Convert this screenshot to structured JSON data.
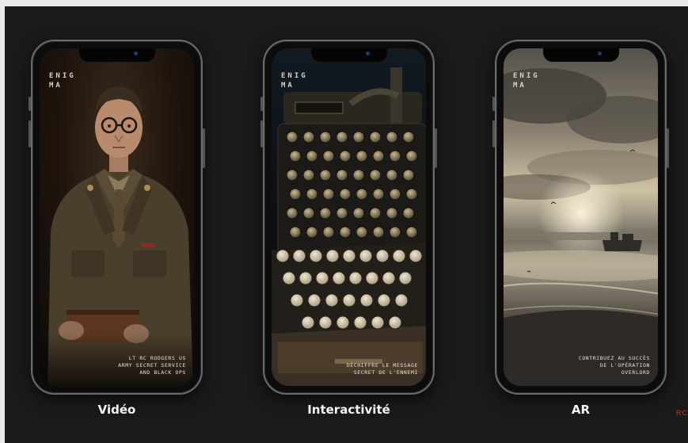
{
  "phones": [
    {
      "logo": "ENIGMA",
      "caption_lines": [
        "LT RC RODGERS US",
        "ARMY SECRET SERVICE",
        "AND BLACK OPS"
      ],
      "label": "Vidéo"
    },
    {
      "logo": "ENIGMA",
      "caption_lines": [
        "DÉCHIFFRE LE MESSAGE",
        "SECRET DE L'ENNEMI"
      ],
      "label": "Interactivité"
    },
    {
      "logo": "ENIGMA",
      "caption_lines": [
        "CONTRIBUEZ AU SUCCÈS",
        "DE L'OPÉRATION",
        "OVERLORD"
      ],
      "label": "AR"
    }
  ],
  "corner_text": "RC",
  "colors": {
    "stage": "#1a1a1a",
    "label": "#f4f4f4",
    "corner_text": "#c0392b"
  }
}
